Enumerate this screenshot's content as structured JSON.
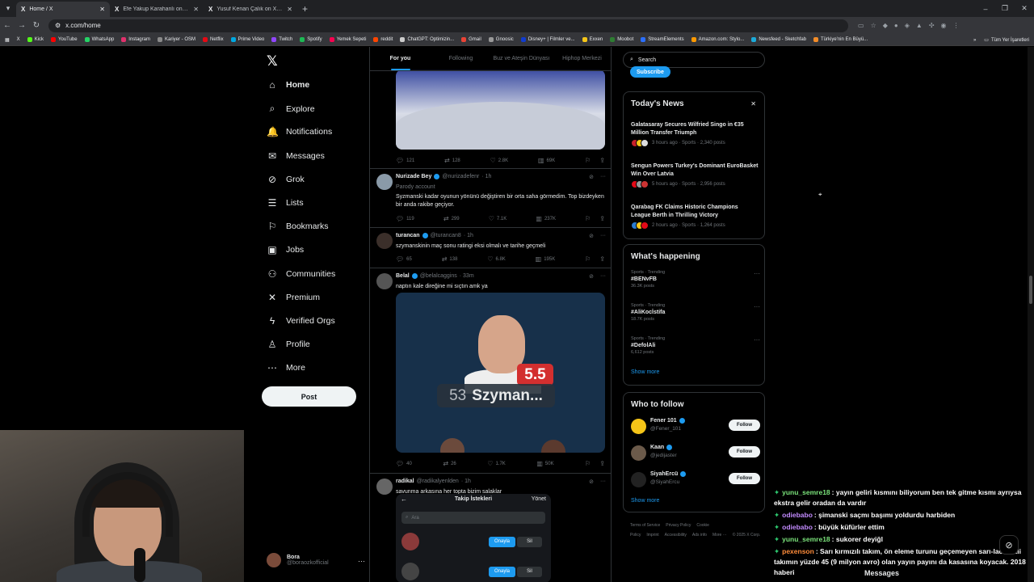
{
  "browser": {
    "tabs": [
      {
        "title": "Home / X",
        "active": true
      },
      {
        "title": "Efe Yakup Karahanlı on X: \"Benî",
        "active": false
      },
      {
        "title": "Yusuf Kenan Çalık on X: \"Yok m",
        "active": false
      }
    ],
    "url": "x.com/home",
    "bookmarks": [
      {
        "label": "Kick",
        "color": "#53fc18"
      },
      {
        "label": "YouTube",
        "color": "#ff0000"
      },
      {
        "label": "WhatsApp",
        "color": "#25d366"
      },
      {
        "label": "Instagram",
        "color": "#e1306c"
      },
      {
        "label": "Kariyer - OSM",
        "color": "#8a8a8a"
      },
      {
        "label": "Netflix",
        "color": "#e50914"
      },
      {
        "label": "Prime Video",
        "color": "#00a8e1"
      },
      {
        "label": "Twitch",
        "color": "#9146ff"
      },
      {
        "label": "Spotify",
        "color": "#1db954"
      },
      {
        "label": "Yemek Sepeti",
        "color": "#fa0050"
      },
      {
        "label": "reddit",
        "color": "#ff4500"
      },
      {
        "label": "ChatGPT: Optimizin...",
        "color": "#cccccc"
      },
      {
        "label": "Gmail",
        "color": "#ea4335"
      },
      {
        "label": "Gnoosic",
        "color": "#999999"
      },
      {
        "label": "Disney+ | Filmler ve...",
        "color": "#113ccf"
      },
      {
        "label": "Exxen",
        "color": "#f5c518"
      },
      {
        "label": "Moobot",
        "color": "#2e7d32"
      },
      {
        "label": "StreamElements",
        "color": "#2b6fff"
      },
      {
        "label": "Amazon.com: Stylo...",
        "color": "#ff9900"
      },
      {
        "label": "Newsfeed - Sketchfab",
        "color": "#1caad9"
      },
      {
        "label": "Türkiye'nin En Büyü...",
        "color": "#f28c28"
      }
    ],
    "all_bookmarks": "Tüm Yer İşaretleri"
  },
  "nav": {
    "items": [
      {
        "label": "Home",
        "icon": "home-icon",
        "glyph": "⌂"
      },
      {
        "label": "Explore",
        "icon": "search-icon",
        "glyph": "⌕"
      },
      {
        "label": "Notifications",
        "icon": "bell-icon",
        "glyph": "🔔"
      },
      {
        "label": "Messages",
        "icon": "envelope-icon",
        "glyph": "✉"
      },
      {
        "label": "Grok",
        "icon": "grok-icon",
        "glyph": "⊘"
      },
      {
        "label": "Lists",
        "icon": "list-icon",
        "glyph": "☰"
      },
      {
        "label": "Bookmarks",
        "icon": "bookmark-icon",
        "glyph": "⚐"
      },
      {
        "label": "Jobs",
        "icon": "briefcase-icon",
        "glyph": "▣"
      },
      {
        "label": "Communities",
        "icon": "people-icon",
        "glyph": "⚇"
      },
      {
        "label": "Premium",
        "icon": "x-icon",
        "glyph": "✕"
      },
      {
        "label": "Verified Orgs",
        "icon": "lightning-icon",
        "glyph": "ϟ"
      },
      {
        "label": "Profile",
        "icon": "person-icon",
        "glyph": "♙"
      },
      {
        "label": "More",
        "icon": "more-circle-icon",
        "glyph": "⋯"
      }
    ],
    "post_label": "Post",
    "account": {
      "name": "Bora",
      "handle": "@boraozkofficial"
    }
  },
  "feed": {
    "tabs": [
      "For you",
      "Following",
      "Buz ve Ateşin Dünyası",
      "Hiphop Merkezi"
    ],
    "first_actions": {
      "replies": "121",
      "reposts": "128",
      "likes": "2.8K",
      "views": "69K"
    },
    "tweets": [
      {
        "name": "Nurizade Bey",
        "handle": "@nurizadefenr",
        "time": "· 1h",
        "sub": "Parody account",
        "text": "Syzmanski kadar oyunun yönünü değiştiren bir orta saha görmedim. Top bizdeyken bir anda rakibe geçiyor.",
        "replies": "119",
        "reposts": "299",
        "likes": "7.1K",
        "views": "237K"
      },
      {
        "name": "turancan",
        "handle": "@turancan8",
        "time": "· 1h",
        "text": "szymanskinin maç sonu ratingi eksi olmalı ve tarihe geçmeli",
        "replies": "65",
        "reposts": "138",
        "likes": "6.8K",
        "views": "195K"
      },
      {
        "name": "Belal",
        "handle": "@belalcaggins",
        "time": "· 33m",
        "text": "naptın kale direğine mi sıçtın amk ya",
        "media": {
          "rating": "5.5",
          "number": "53",
          "player": "Szyman..."
        },
        "replies": "40",
        "reposts": "26",
        "likes": "1.7K",
        "views": "50K"
      },
      {
        "name": "radikal",
        "handle": "@radikalyenlden",
        "time": "· 1h",
        "text": "savunma arkasına her topta bizim salaklar",
        "media": {
          "title": "Takip İstekleri",
          "manage": "Yönet",
          "search": "Ara",
          "approve": "Onayla",
          "delete": "Sil"
        }
      }
    ]
  },
  "right": {
    "search_placeholder": "Search",
    "subscribe": "Subscribe",
    "news_title": "Today's News",
    "news": [
      {
        "headline": "Galatasaray Secures Wilfried Singo in €35 Million Transfer Triumph",
        "meta": "3 hours ago · Sports · 2,340 posts"
      },
      {
        "headline": "Sengun Powers Turkey's Dominant EuroBasket Win Over Latvia",
        "meta": "5 hours ago · Sports · 2,956 posts"
      },
      {
        "headline": "Qarabag FK Claims Historic Champions League Berth in Thrilling Victory",
        "meta": "2 hours ago · Sports · 1,264 posts"
      }
    ],
    "happening_title": "What's happening",
    "trends": [
      {
        "category": "Sports · Trending",
        "tag": "#BENvFB",
        "posts": "36.3K posts"
      },
      {
        "category": "Sports · Trending",
        "tag": "#AliKocİstifa",
        "posts": "18.7K posts"
      },
      {
        "category": "Sports · Trending",
        "tag": "#DefolAli",
        "posts": "6,612 posts"
      }
    ],
    "show_more": "Show more",
    "wtf_title": "Who to follow",
    "follow_label": "Follow",
    "who_to_follow": [
      {
        "name": "Fener 101",
        "handle": "@Fener_101",
        "color": "#f5c518"
      },
      {
        "name": "Kaan",
        "handle": "@jedijaster",
        "color": "#6b5a4a"
      },
      {
        "name": "SiyahErcü",
        "handle": "@SiyahErcu",
        "color": "#222222"
      }
    ],
    "footer": [
      "Terms of Service",
      "Privacy Policy",
      "Cookie Policy",
      "Imprint",
      "Accessibility",
      "Ads info",
      "More ···",
      "© 2025 X Corp."
    ]
  },
  "chat": [
    {
      "user": "yunu_semre18",
      "color": "#7be37b",
      "text": ": yayın geliri kısmını biliyorum ben tek gitme kısmı ayrıysa ekstra gelir oradan da vardır"
    },
    {
      "user": "odiebabo",
      "color": "#c38bff",
      "text": ": şimanski saçmı başımı yoldurdu harbiden"
    },
    {
      "user": "odiebabo",
      "color": "#c38bff",
      "text": ": büyük küfürler ettim"
    },
    {
      "user": "yunu_semre18",
      "color": "#7be37b",
      "text": ": sukorer deyiğl"
    },
    {
      "user": "pexenson",
      "color": "#ff8c3a",
      "text": ": Sarı kırmızılı takım, ön eleme turunu geçemeyen sarı-lacivertli takımın yüzde 45 (9 milyon avro) olan yayın payını da kasasına koyacak. 2018 haberi"
    }
  ],
  "messages_drawer": "Messages"
}
